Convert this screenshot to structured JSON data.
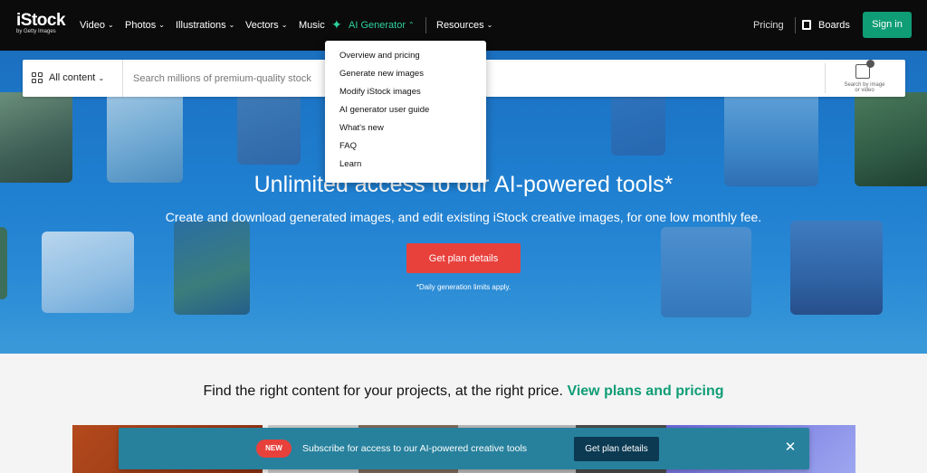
{
  "logo": {
    "main": "iStock",
    "sub": "by Getty Images"
  },
  "nav": {
    "items": [
      {
        "label": "Video",
        "chevron": true
      },
      {
        "label": "Photos",
        "chevron": true
      },
      {
        "label": "Illustrations",
        "chevron": true
      },
      {
        "label": "Vectors",
        "chevron": true
      },
      {
        "label": "Music",
        "chevron": false
      },
      {
        "label": "AI Generator",
        "chevron": true,
        "open": true
      },
      {
        "label": "Resources",
        "chevron": true
      }
    ],
    "pricing": "Pricing",
    "boards": "Boards",
    "signin": "Sign in"
  },
  "ai_dropdown": [
    "Overview and pricing",
    "Generate new images",
    "Modify iStock images",
    "AI generator user guide",
    "What's new",
    "FAQ",
    "Learn"
  ],
  "search": {
    "filter": "All content",
    "placeholder": "Search millions of premium-quality stock",
    "by_image_line1": "Search by image",
    "by_image_line2": "or video"
  },
  "hero": {
    "title": "Unlimited access to our AI-powered tools*",
    "subtitle": "Create and download generated images, and edit existing iStock creative images, for one low monthly fee.",
    "cta": "Get plan details",
    "note": "*Daily generation limits apply."
  },
  "pricing": {
    "text": "Find the right content for your projects, at the right price.",
    "link": "View plans and pricing"
  },
  "banner": {
    "badge": "NEW",
    "text": "Subscribe for access to our AI-powered creative tools",
    "button": "Get plan details"
  },
  "colors": {
    "accent_green": "#0f9d76",
    "nav_green": "#2fd1a0",
    "cta_red": "#e8413c",
    "banner_teal": "#27819d"
  }
}
